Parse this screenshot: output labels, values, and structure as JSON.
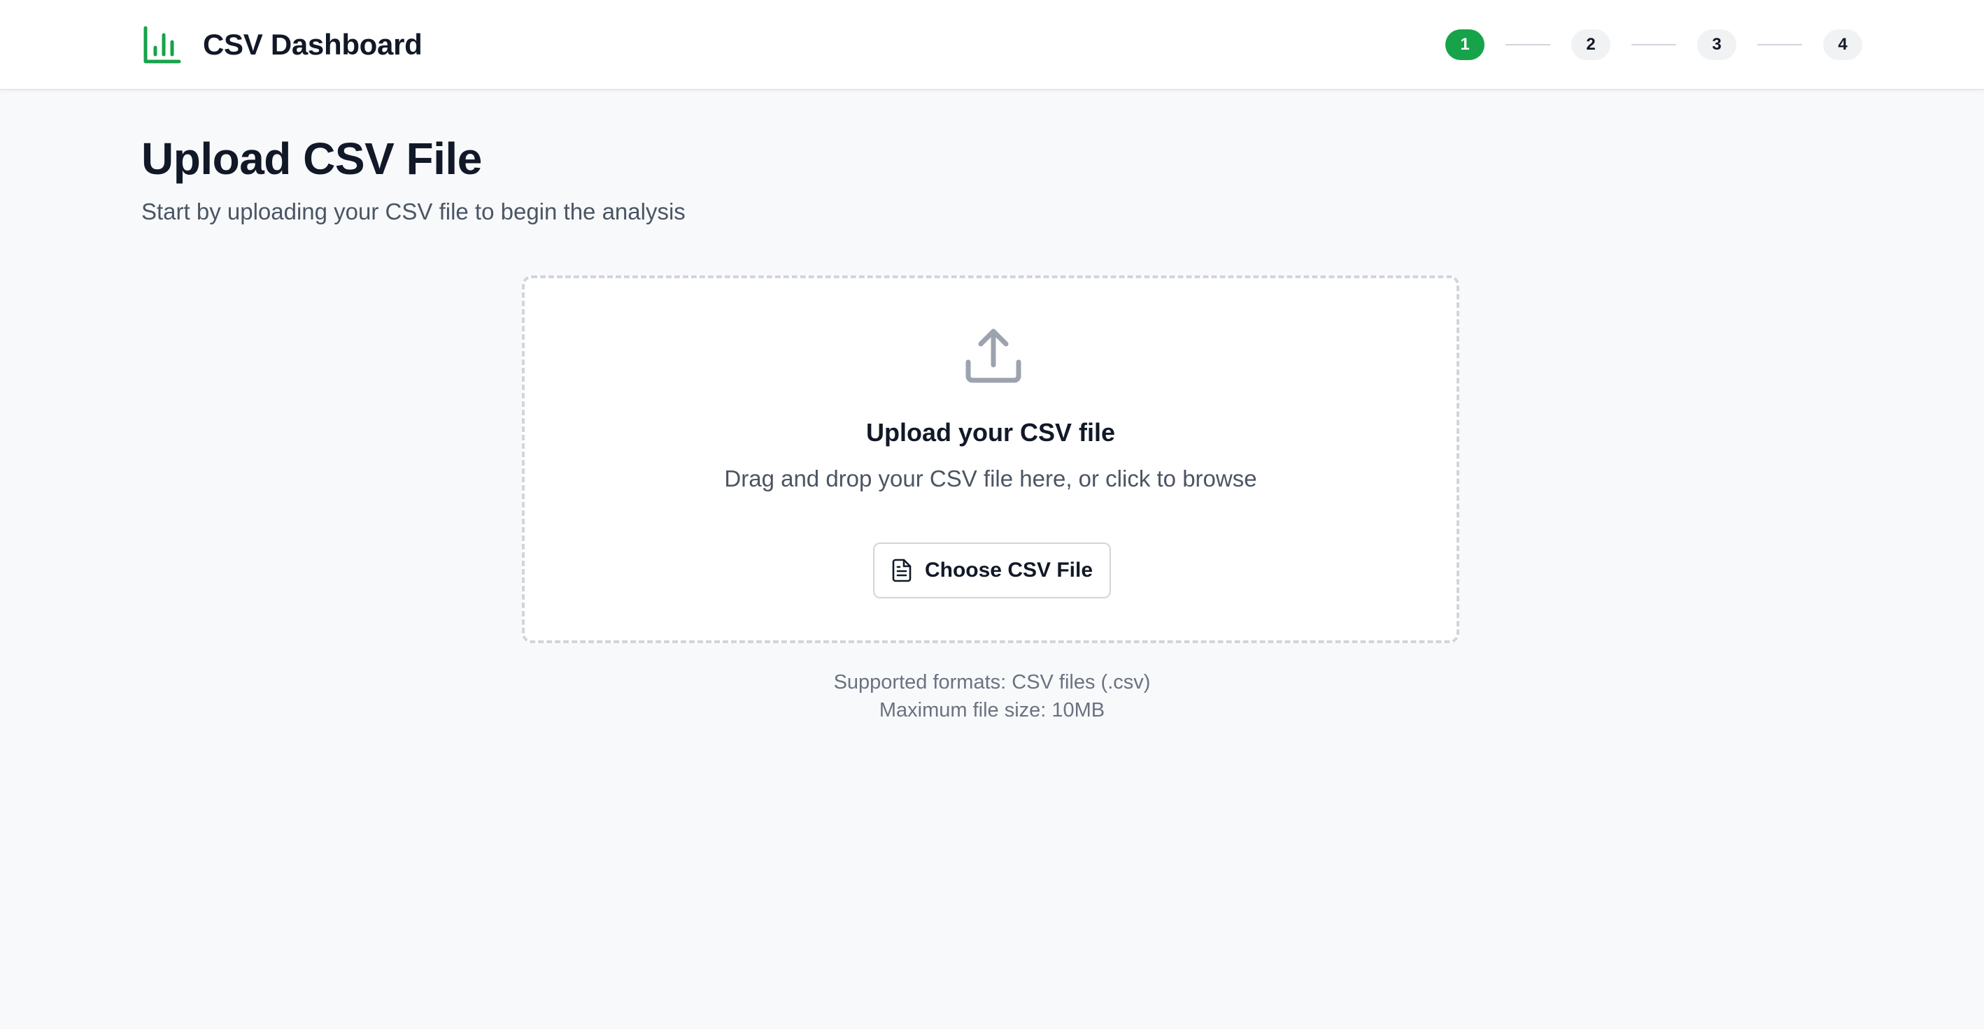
{
  "app": {
    "title": "CSV Dashboard",
    "accent_color": "#16a34a",
    "logo_icon": "bar-chart-icon"
  },
  "steps": [
    {
      "label": "1",
      "active": true
    },
    {
      "label": "2",
      "active": false
    },
    {
      "label": "3",
      "active": false
    },
    {
      "label": "4",
      "active": false
    }
  ],
  "page": {
    "title": "Upload CSV File",
    "subtitle": "Start by uploading your CSV file to begin the analysis"
  },
  "dropzone": {
    "icon": "upload-icon",
    "heading": "Upload your CSV file",
    "description": "Drag and drop your CSV file here, or click to browse",
    "button_icon": "file-text-icon",
    "button_label": "Choose CSV File"
  },
  "info": {
    "formats": "Supported formats: CSV files (.csv)",
    "max_size": "Maximum file size: 10MB"
  }
}
